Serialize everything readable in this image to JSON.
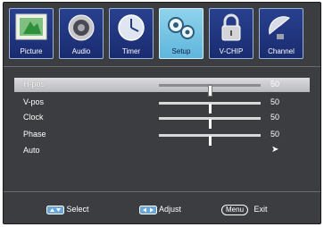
{
  "tabs": [
    {
      "label": "Picture",
      "icon": "picture-icon",
      "active": false
    },
    {
      "label": "Audio",
      "icon": "speaker-icon",
      "active": false
    },
    {
      "label": "Timer",
      "icon": "clock-icon",
      "active": false
    },
    {
      "label": "Setup",
      "icon": "gears-icon",
      "active": true
    },
    {
      "label": "V-CHIP",
      "icon": "lock-icon",
      "active": false
    },
    {
      "label": "Channel",
      "icon": "satellite-dish-icon",
      "active": false
    }
  ],
  "setup": {
    "items": [
      {
        "label": "H-pos",
        "value": "50",
        "level": 0.5,
        "selected": true
      },
      {
        "label": "V-pos",
        "value": "50",
        "level": 0.5,
        "selected": false
      },
      {
        "label": "Clock",
        "value": "50",
        "level": 0.5,
        "selected": false
      },
      {
        "label": "Phase",
        "value": "50",
        "level": 0.5,
        "selected": false
      },
      {
        "label": "Auto",
        "arrow": "➤",
        "selected": false
      }
    ]
  },
  "footer": {
    "select_label": "Select",
    "adjust_label": "Adjust",
    "menu_key": "Menu",
    "exit_label": "Exit"
  },
  "colors": {
    "panel_background": "#3c3d41",
    "tab_background": "#1a2c70",
    "active_tab": "#7cc8e8",
    "selected_row": "#c9cacd"
  }
}
